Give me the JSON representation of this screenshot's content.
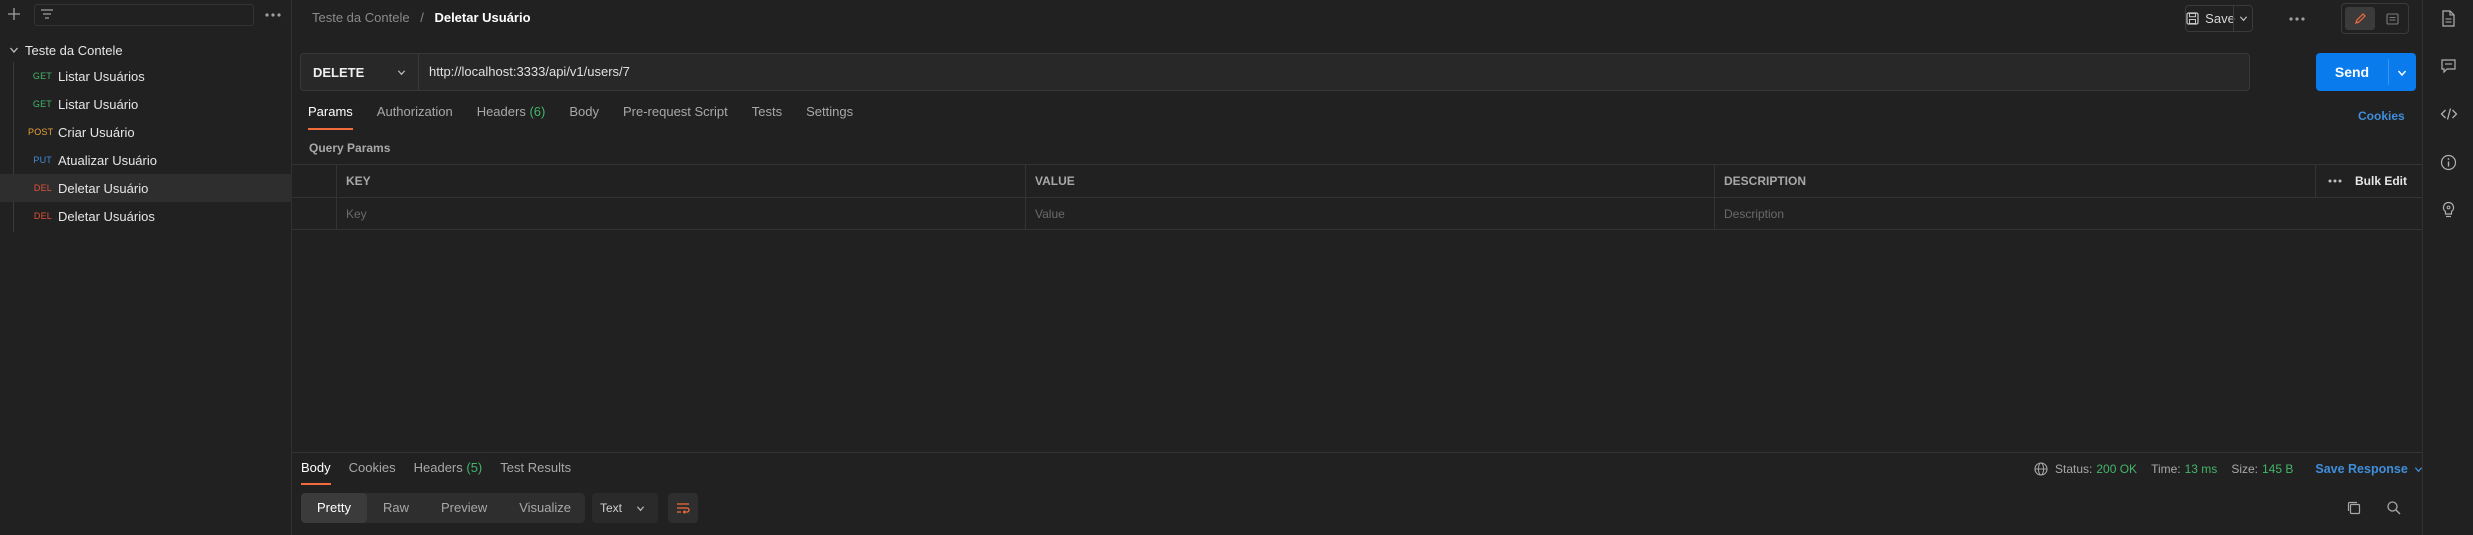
{
  "sidebar": {
    "collection": "Teste da Contele",
    "requests": [
      {
        "method": "GET",
        "name": "Listar Usuários",
        "color": "#43b56b",
        "active": false
      },
      {
        "method": "GET",
        "name": "Listar Usuário",
        "color": "#43b56b",
        "active": false
      },
      {
        "method": "POST",
        "name": "Criar Usuário",
        "color": "#e8a23a",
        "active": false
      },
      {
        "method": "PUT",
        "name": "Atualizar Usuário",
        "color": "#3f8edb",
        "active": false
      },
      {
        "method": "DEL",
        "name": "Deletar Usuário",
        "color": "#e0523a",
        "active": true
      },
      {
        "method": "DEL",
        "name": "Deletar Usuários",
        "color": "#e0523a",
        "active": false
      }
    ]
  },
  "header": {
    "breadcrumb_parent": "Teste da Contele",
    "breadcrumb_sep": "/",
    "breadcrumb_current": "Deletar Usuário",
    "save_label": "Save"
  },
  "request": {
    "method": "DELETE",
    "url": "http://localhost:3333/api/v1/users/7",
    "send_label": "Send"
  },
  "tabs": {
    "params": "Params",
    "authorization": "Authorization",
    "headers": "Headers",
    "headers_count": "(6)",
    "body": "Body",
    "prerequest": "Pre-request Script",
    "tests": "Tests",
    "settings": "Settings",
    "cookies": "Cookies"
  },
  "params": {
    "section_label": "Query Params",
    "col_key": "KEY",
    "col_value": "VALUE",
    "col_description": "DESCRIPTION",
    "bulk_edit": "Bulk Edit",
    "ph_key": "Key",
    "ph_value": "Value",
    "ph_description": "Description"
  },
  "response": {
    "tab_body": "Body",
    "tab_cookies": "Cookies",
    "tab_headers": "Headers",
    "tab_headers_count": "(5)",
    "tab_tests": "Test Results",
    "status_label": "Status:",
    "status_value": "200 OK",
    "time_label": "Time:",
    "time_value": "13 ms",
    "size_label": "Size:",
    "size_value": "145 B",
    "save_response": "Save Response",
    "views": [
      "Pretty",
      "Raw",
      "Preview",
      "Visualize"
    ],
    "selected_view": "Pretty",
    "format": "Text"
  },
  "colors": {
    "accent": "#f26b3a",
    "send": "#097bed",
    "link": "#3f8edb",
    "success": "#43b56b"
  }
}
